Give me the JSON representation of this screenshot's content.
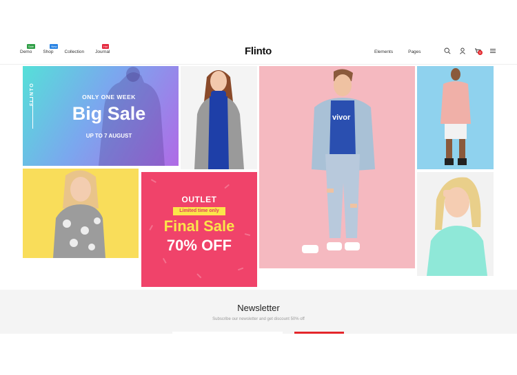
{
  "header": {
    "logo": "Flinto",
    "nav_left": [
      {
        "label": "Demo",
        "badge": "Sale",
        "badge_color": "#2e9e45"
      },
      {
        "label": "Shop",
        "badge": "New",
        "badge_color": "#2a84e4"
      },
      {
        "label": "Collection",
        "badge": "",
        "badge_color": ""
      },
      {
        "label": "Journal",
        "badge": "Hot",
        "badge_color": "#e4263c"
      }
    ],
    "nav_right": [
      "Elements",
      "Pages"
    ],
    "icons": [
      "search-icon",
      "user-icon",
      "cart-icon",
      "menu-icon"
    ],
    "cart_count": "0"
  },
  "banners": {
    "big_sale": {
      "brand": "FLINTO",
      "top_text": "ONLY ONE WEEK",
      "title": "Big Sale",
      "date_text": "UP TO 7 AUGUST"
    },
    "outlet": {
      "heading": "OUTLET",
      "tag": "Limited time only",
      "title": "Final Sale",
      "discount": "70% OFF"
    },
    "center_shirt_text": "vivor"
  },
  "newsletter": {
    "title": "Newsletter",
    "subtitle": "Subscribe our newsletter and get discount 50% off"
  },
  "colors": {
    "accent": "#e4262b",
    "outlet_bg": "#f0436a",
    "outlet_yellow": "#fbe54a",
    "kid_bg": "#f9dd5a",
    "pink_bg": "#f5b9c0",
    "blue_bg": "#8fd2ee"
  }
}
